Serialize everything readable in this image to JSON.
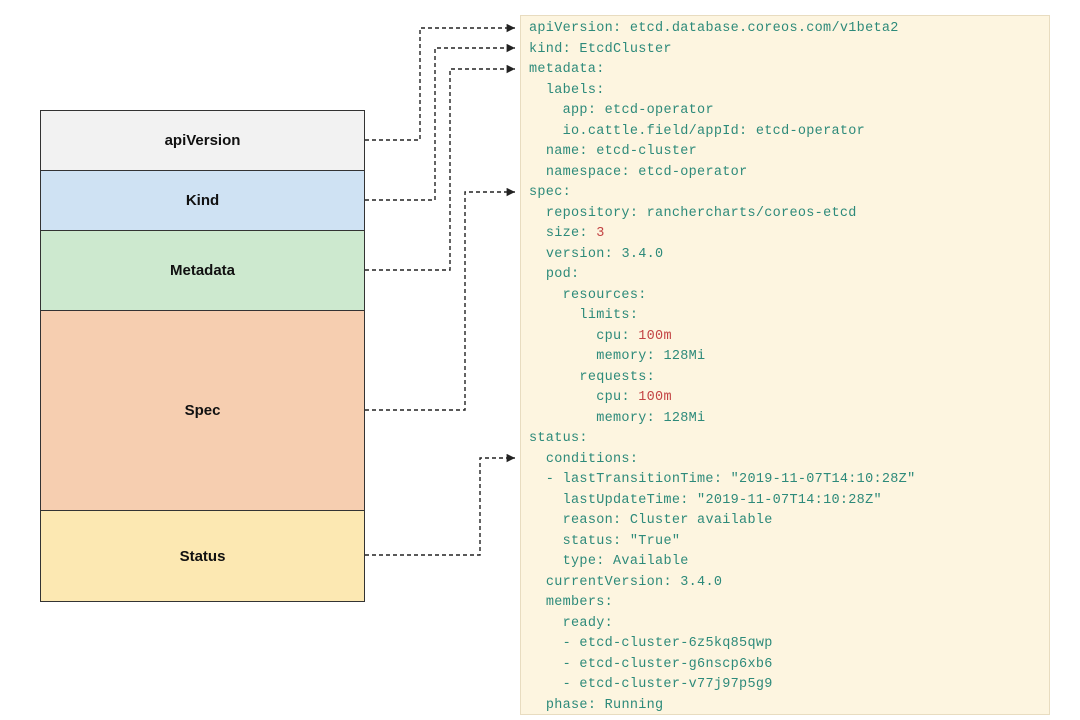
{
  "boxes": {
    "apiVersion": "apiVersion",
    "kind": "Kind",
    "metadata": "Metadata",
    "spec": "Spec",
    "status": "Status"
  },
  "yaml": {
    "apiVersion": {
      "key": "apiVersion",
      "value": "etcd.database.coreos.com/v1beta2"
    },
    "kind": {
      "key": "kind",
      "value": "EtcdCluster"
    },
    "metadata": {
      "key": "metadata",
      "labels_key": "labels",
      "app": {
        "key": "app",
        "value": "etcd-operator"
      },
      "appId": {
        "key": "io.cattle.field/appId",
        "value": "etcd-operator"
      },
      "name": {
        "key": "name",
        "value": "etcd-cluster"
      },
      "namespace": {
        "key": "namespace",
        "value": "etcd-operator"
      }
    },
    "spec": {
      "key": "spec",
      "repository": {
        "key": "repository",
        "value": "ranchercharts/coreos-etcd"
      },
      "size": {
        "key": "size",
        "value": "3"
      },
      "version": {
        "key": "version",
        "value": "3.4.0"
      },
      "pod_key": "pod",
      "resources_key": "resources",
      "limits_key": "limits",
      "requests_key": "requests",
      "cpu": {
        "key": "cpu",
        "value": "100m"
      },
      "memory": {
        "key": "memory",
        "value": "128Mi"
      }
    },
    "status": {
      "key": "status",
      "conditions_key": "conditions",
      "lastTransitionTime": {
        "key": "lastTransitionTime",
        "value": "\"2019-11-07T14:10:28Z\""
      },
      "lastUpdateTime": {
        "key": "lastUpdateTime",
        "value": "\"2019-11-07T14:10:28Z\""
      },
      "reason": {
        "key": "reason",
        "value": "Cluster available"
      },
      "status_field": {
        "key": "status",
        "value": "\"True\""
      },
      "type": {
        "key": "type",
        "value": "Available"
      },
      "currentVersion": {
        "key": "currentVersion",
        "value": "3.4.0"
      },
      "members_key": "members",
      "ready_key": "ready",
      "member1": "etcd-cluster-6z5kq85qwp",
      "member2": "etcd-cluster-g6nscp6xb6",
      "member3": "etcd-cluster-v77j97p5g9",
      "phase": {
        "key": "phase",
        "value": "Running"
      }
    }
  }
}
